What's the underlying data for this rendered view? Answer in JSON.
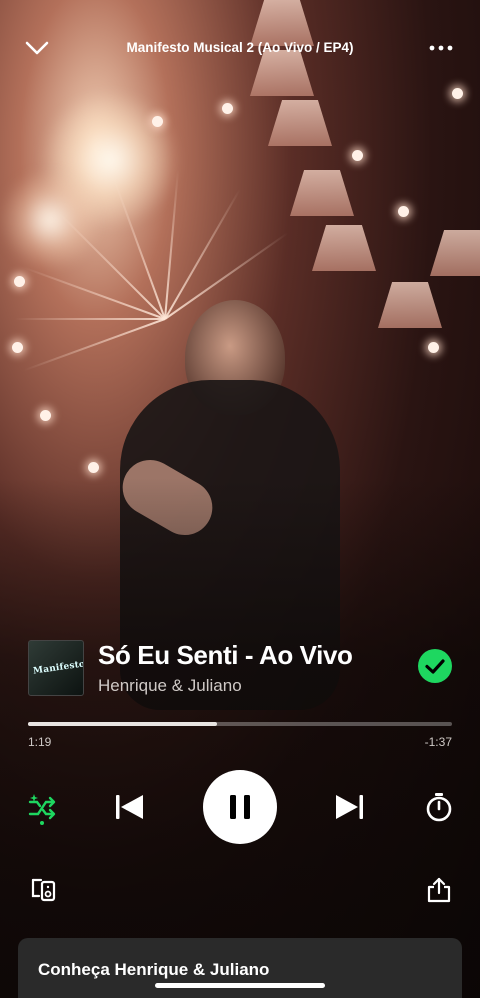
{
  "header": {
    "title": "Manifesto Musical 2 (Ao Vivo / EP4)",
    "collapse_icon": "chevron-down-icon",
    "more_icon": "more-horizontal-icon"
  },
  "track": {
    "title": "Só Eu Senti - Ao Vivo",
    "artist": "Henrique & Juliano",
    "cover_text": "Manifesto",
    "liked_icon": "check-circle-icon",
    "liked_color": "#1ed760"
  },
  "playback": {
    "elapsed": "1:19",
    "remaining": "-1:37",
    "progress_fraction": 0.446
  },
  "controls": {
    "shuffle_icon": "smart-shuffle-icon",
    "prev_icon": "skip-previous-icon",
    "play_icon": "pause-icon",
    "next_icon": "skip-next-icon",
    "timer_icon": "sleep-timer-icon",
    "accent_color": "#1ed760"
  },
  "footer": {
    "devices_icon": "connect-device-icon",
    "share_icon": "share-icon",
    "artist_card_label": "Conheça Henrique & Juliano"
  }
}
